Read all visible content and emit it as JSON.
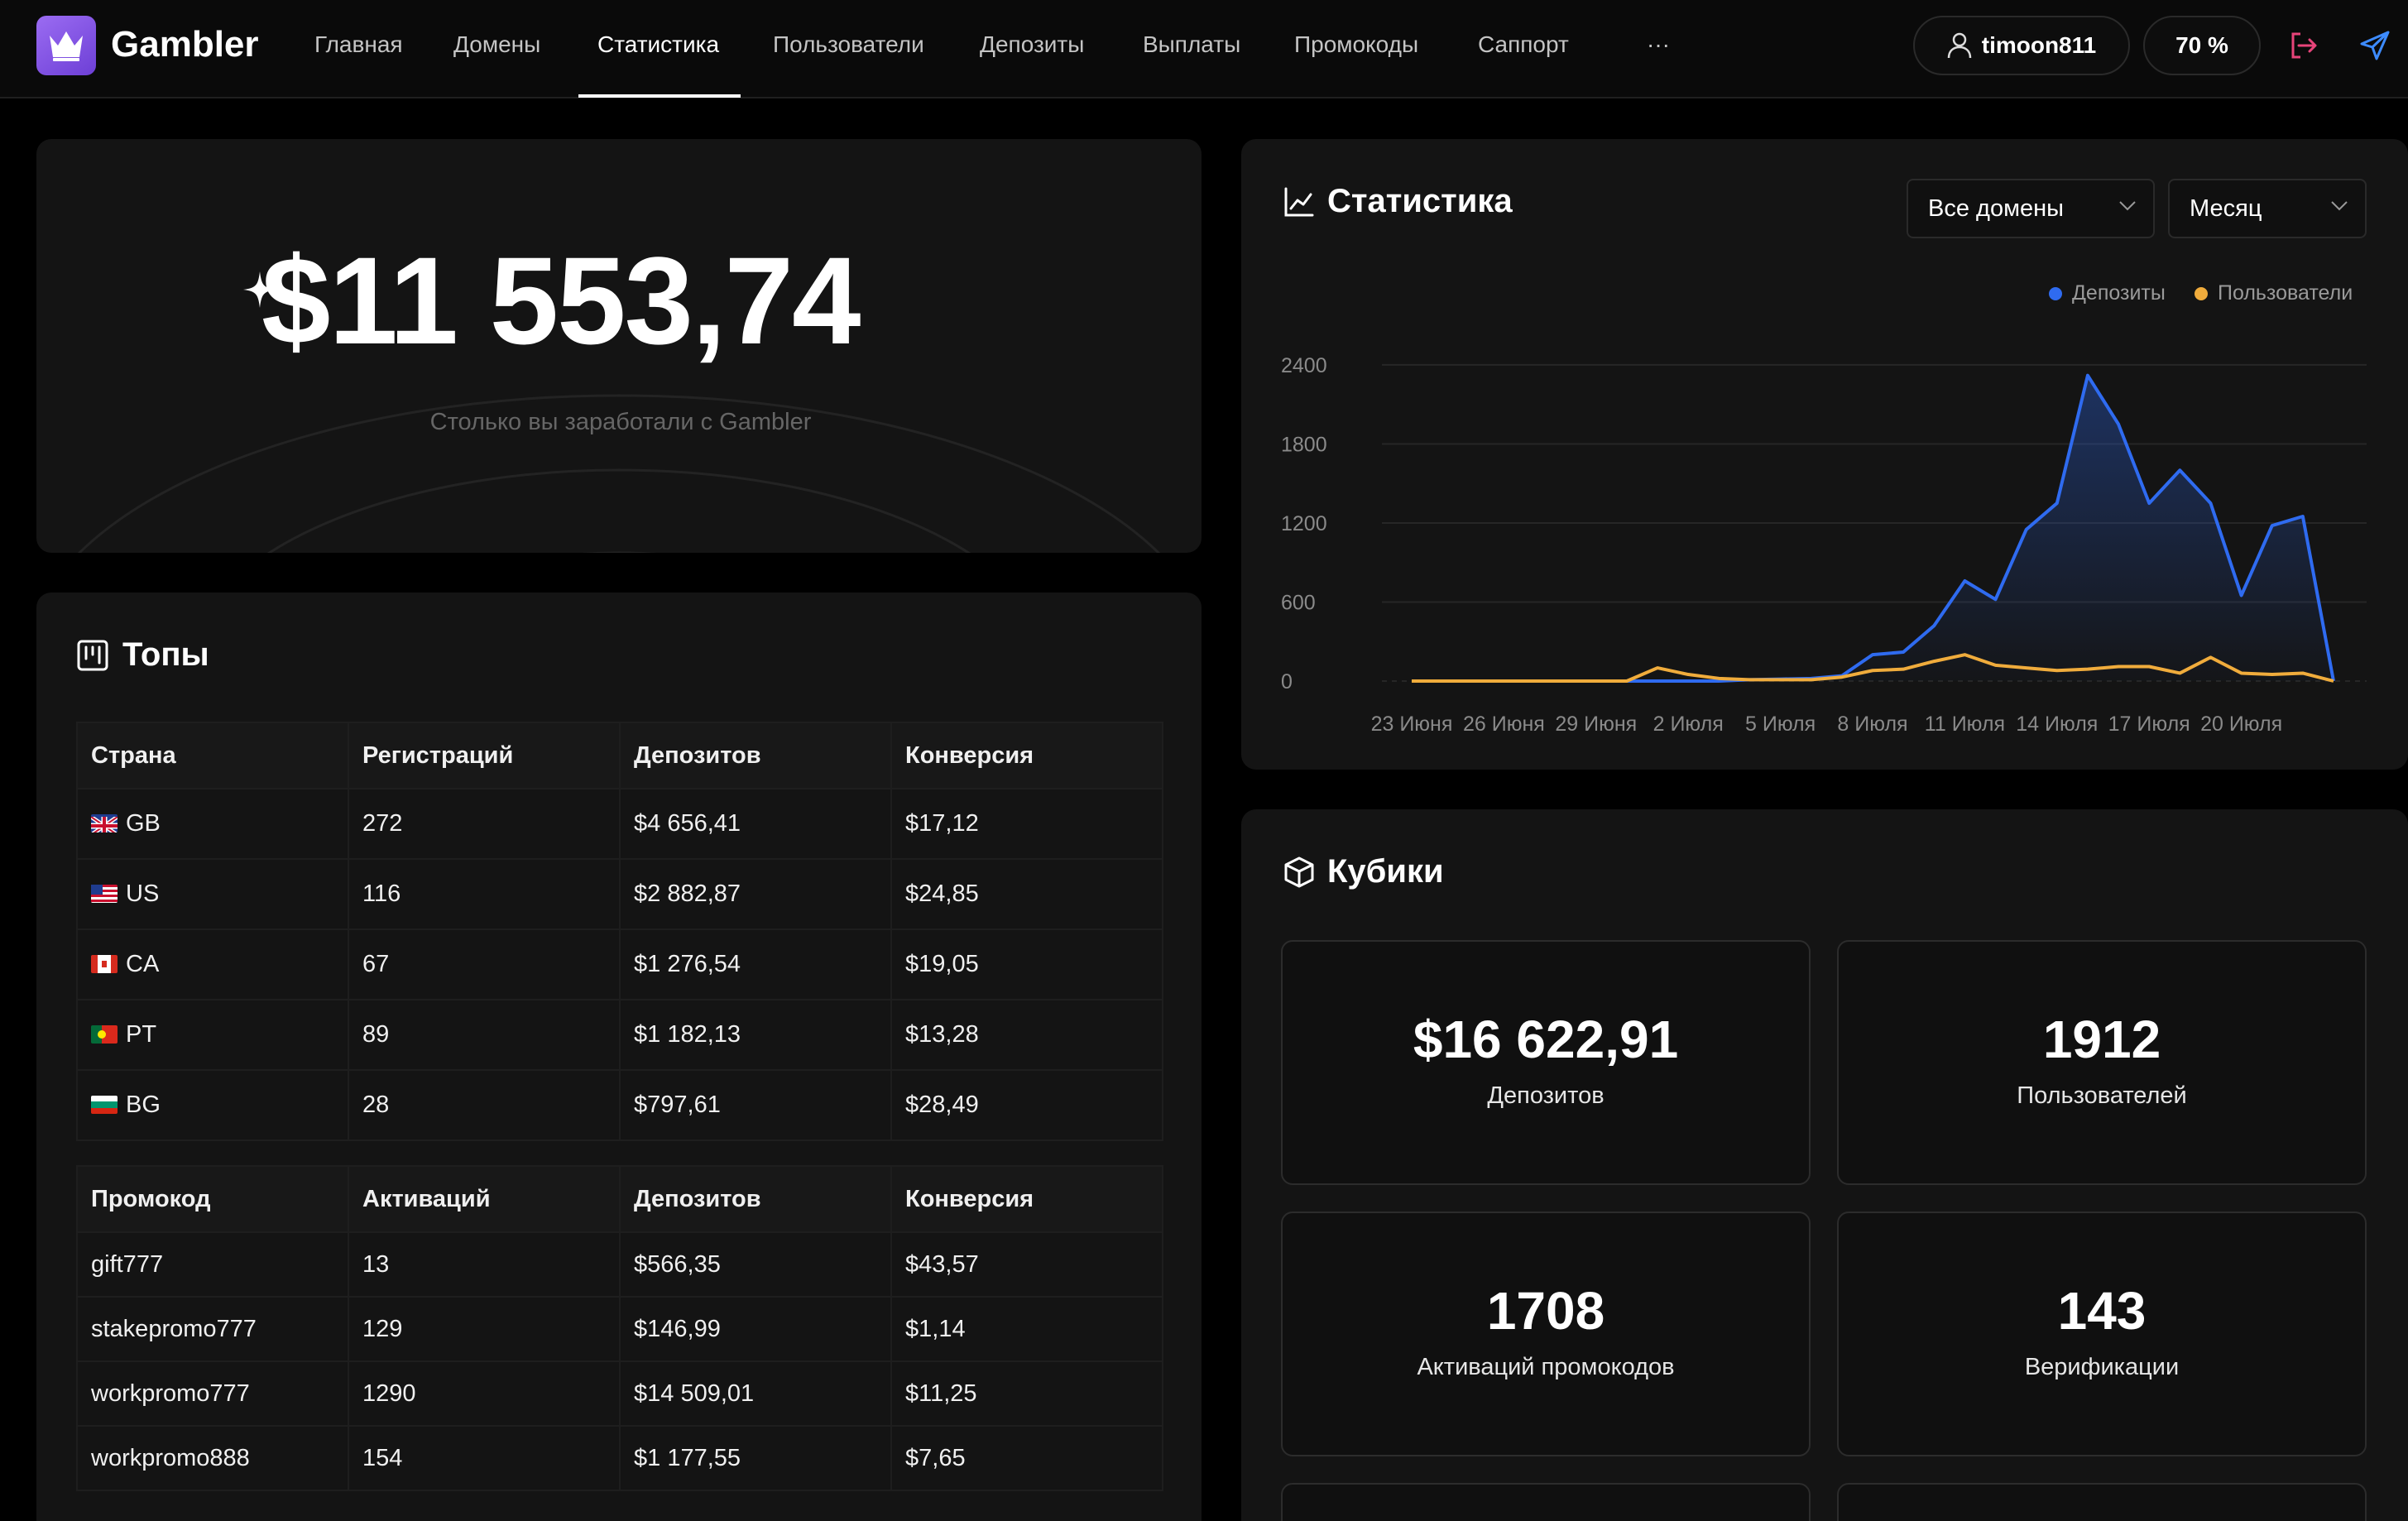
{
  "app": {
    "name": "Gambler"
  },
  "nav": {
    "items": [
      {
        "label": "Главная"
      },
      {
        "label": "Домены"
      },
      {
        "label": "Статистика",
        "active": true
      },
      {
        "label": "Пользователи"
      },
      {
        "label": "Депозиты"
      },
      {
        "label": "Выплаты"
      },
      {
        "label": "Промокоды"
      },
      {
        "label": "Саппорт"
      }
    ],
    "more": "···",
    "username": "timoon811",
    "percent": "70 %"
  },
  "earnings": {
    "amount": "$11 553,74",
    "subtitle": "Столько вы заработали с Gambler"
  },
  "tops": {
    "title": "Топы",
    "countries": {
      "headers": [
        "Страна",
        "Регистраций",
        "Депозитов",
        "Конверсия"
      ],
      "rows": [
        {
          "country": "GB",
          "registrations": "272",
          "deposits": "$4 656,41",
          "conversion": "$17,12"
        },
        {
          "country": "US",
          "registrations": "116",
          "deposits": "$2 882,87",
          "conversion": "$24,85"
        },
        {
          "country": "CA",
          "registrations": "67",
          "deposits": "$1 276,54",
          "conversion": "$19,05"
        },
        {
          "country": "PT",
          "registrations": "89",
          "deposits": "$1 182,13",
          "conversion": "$13,28"
        },
        {
          "country": "BG",
          "registrations": "28",
          "deposits": "$797,61",
          "conversion": "$28,49"
        }
      ]
    },
    "promos": {
      "headers": [
        "Промокод",
        "Активаций",
        "Депозитов",
        "Конверсия"
      ],
      "rows": [
        {
          "code": "gift777",
          "activations": "13",
          "deposits": "$566,35",
          "conversion": "$43,57"
        },
        {
          "code": "stakepromo777",
          "activations": "129",
          "deposits": "$146,99",
          "conversion": "$1,14"
        },
        {
          "code": "workpromo777",
          "activations": "1290",
          "deposits": "$14 509,01",
          "conversion": "$11,25"
        },
        {
          "code": "workpromo888",
          "activations": "154",
          "deposits": "$1 177,55",
          "conversion": "$7,65"
        }
      ]
    }
  },
  "stats": {
    "title": "Статистика",
    "domain_select": "Все домены",
    "period_select": "Месяц"
  },
  "colors": {
    "deposits": "#2f6bf0",
    "users": "#f0ac3c",
    "accent": "#7c4ddc"
  },
  "chart_data": {
    "type": "line",
    "x": [
      "23 Июня",
      "24 Июня",
      "25 Июня",
      "26 Июня",
      "27 Июня",
      "28 Июня",
      "29 Июня",
      "30 Июня",
      "1 Июля",
      "2 Июля",
      "3 Июля",
      "4 Июля",
      "5 Июля",
      "6 Июля",
      "7 Июля",
      "8 Июля",
      "9 Июля",
      "10 Июля",
      "11 Июля",
      "12 Июля",
      "13 Июля",
      "14 Июля",
      "15 Июля",
      "16 Июля",
      "17 Июля",
      "18 Июля",
      "19 Июля",
      "20 Июля",
      "21 Июля",
      "22 Июля",
      "23 Июля"
    ],
    "tick_labels": [
      "23 Июня",
      "26 Июня",
      "29 Июня",
      "2 Июля",
      "5 Июля",
      "8 Июля",
      "11 Июля",
      "14 Июля",
      "17 Июля",
      "20 Июля"
    ],
    "series": [
      {
        "name": "Депозиты",
        "color": "#2f6bf0",
        "values": [
          0,
          0,
          0,
          0,
          0,
          0,
          0,
          0,
          0,
          0,
          0,
          10,
          15,
          20,
          40,
          200,
          220,
          420,
          760,
          620,
          1150,
          1350,
          2320,
          1950,
          1350,
          1600,
          1350,
          650,
          1180,
          1250,
          0
        ]
      },
      {
        "name": "Пользователи",
        "color": "#f0ac3c",
        "values": [
          0,
          0,
          0,
          0,
          0,
          0,
          0,
          0,
          100,
          50,
          20,
          10,
          10,
          10,
          30,
          80,
          90,
          150,
          200,
          120,
          100,
          80,
          90,
          110,
          110,
          60,
          180,
          60,
          50,
          60,
          0
        ]
      }
    ],
    "yticks": [
      0,
      600,
      1200,
      1800,
      2400
    ],
    "ylim": [
      0,
      2500
    ],
    "grid": true,
    "legend": "top-right"
  },
  "cubes": {
    "title": "Кубики",
    "items": [
      {
        "value": "$16 622,91",
        "label": "Депозитов"
      },
      {
        "value": "1912",
        "label": "Пользователей"
      },
      {
        "value": "1708",
        "label": "Активаций промокодов"
      },
      {
        "value": "143",
        "label": "Верификации"
      }
    ]
  }
}
